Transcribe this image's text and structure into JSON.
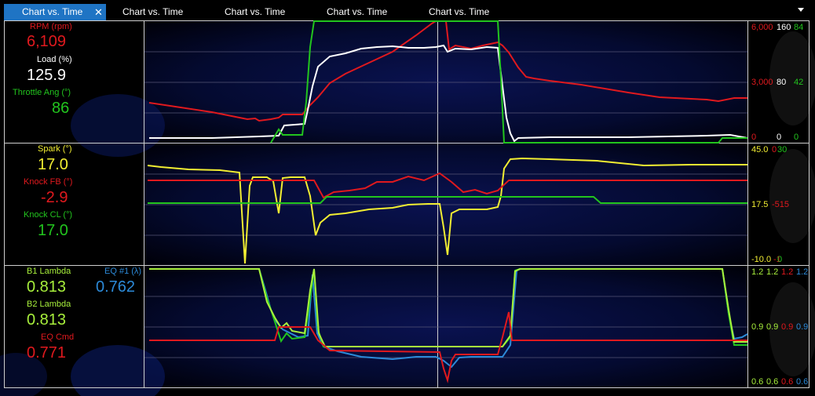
{
  "tabs": [
    {
      "label": "Chart vs. Time",
      "active": true,
      "close": "✕"
    },
    {
      "label": "Chart vs. Time",
      "active": false
    },
    {
      "label": "Chart vs. Time",
      "active": false
    },
    {
      "label": "Chart vs. Time",
      "active": false
    },
    {
      "label": "Chart vs. Time",
      "active": false
    }
  ],
  "colors": {
    "red": "#e0191e",
    "white": "#ffffff",
    "green": "#22c41e",
    "yellow": "#f2ee32",
    "lime": "#a8f03c",
    "blue": "#2c8ad8"
  },
  "panel1": {
    "channels": [
      {
        "label": "RPM (rpm)",
        "value": "6,109",
        "color": "#e0191e"
      },
      {
        "label": "Load (%)",
        "value": "125.9",
        "color": "#ffffff"
      },
      {
        "label": "Throttle Ang (°)",
        "value": "86",
        "color": "#22c41e"
      }
    ],
    "scale_top": [
      "6,000",
      "160",
      "84"
    ],
    "scale_mid": [
      "3,000",
      "80",
      "42"
    ],
    "scale_bot": [
      "0",
      "0",
      "0"
    ]
  },
  "panel2": {
    "channels": [
      {
        "label": "Spark (°)",
        "value": "17.0",
        "color": "#f2ee32"
      },
      {
        "label": "Knock FB (°)",
        "value": "-2.9",
        "color": "#e0191e"
      },
      {
        "label": "Knock CL (°)",
        "value": "17.0",
        "color": "#22c41e"
      }
    ],
    "scale_top": [
      "45.0",
      "0",
      "30"
    ],
    "scale_mid": [
      "17.5",
      "-515"
    ],
    "scale_bot": [
      "-10.0",
      "-1",
      "0"
    ]
  },
  "panel3": {
    "channels": [
      {
        "label": "B1 Lambda",
        "value": "0.813",
        "color": "#a8f03c"
      },
      {
        "label": "EQ #1 (λ)",
        "value": "0.762",
        "color": "#2c8ad8"
      },
      {
        "label": "B2 Lambda",
        "value": "0.813",
        "color": "#a8f03c"
      },
      {
        "label": "EQ Cmd",
        "value": "0.771",
        "color": "#e0191e"
      }
    ],
    "scale_top": [
      "1.2",
      "1.2",
      "1.2",
      "1.2"
    ],
    "scale_mid": [
      "0.9",
      "0.9",
      "0.9",
      "0.9"
    ],
    "scale_bot": [
      "0.6",
      "0.6",
      "0.6",
      "0.6"
    ]
  }
}
